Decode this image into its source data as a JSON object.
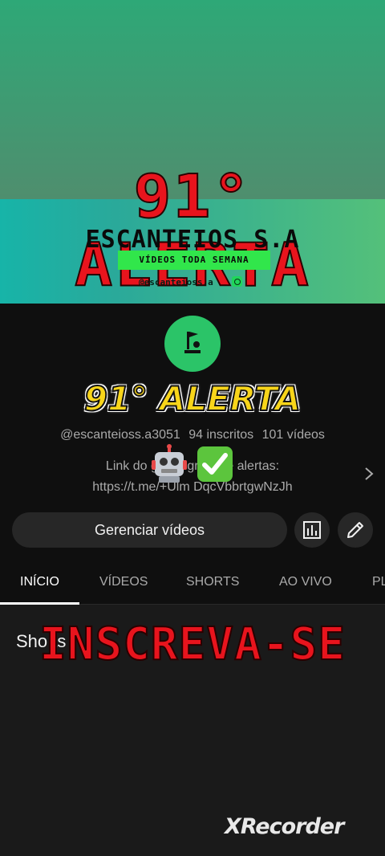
{
  "banner": {
    "title": "91° ALERTA",
    "subtitle": "ESCANTEIOS S.A",
    "chip": "VÍDEOS TODA SEMANA",
    "handle": "@escanteioss.a"
  },
  "overlay": {
    "title": "91° ALERTA",
    "cta": "INSCREVA-SE"
  },
  "channel": {
    "handle": "@escanteioss.a3051",
    "subscribers": "94 inscritos",
    "videos": "101 vídeos",
    "desc_line1": "Link do grupo gr    ito de alertas:",
    "desc_line2": "https://t.me/+Ulm  DqcVbbrtgwNzJh"
  },
  "actions": {
    "manage_label": "Gerenciar vídeos"
  },
  "tabs": [
    {
      "label": "INÍCIO",
      "active": true
    },
    {
      "label": "VÍDEOS",
      "active": false
    },
    {
      "label": "SHORTS",
      "active": false
    },
    {
      "label": "AO VIVO",
      "active": false
    },
    {
      "label": "PL",
      "active": false
    }
  ],
  "section": {
    "label": "Sho   ts"
  },
  "watermark": "XRecorder",
  "icons": [
    "whatsapp-icon",
    "channel-avatar",
    "robot-emoji",
    "check-emoji",
    "chevron-right-icon",
    "analytics-icon",
    "pencil-icon"
  ],
  "colors": {
    "accent_red": "#e8141d",
    "accent_yellow": "#f8d51a",
    "chip_green": "#31e64b"
  }
}
